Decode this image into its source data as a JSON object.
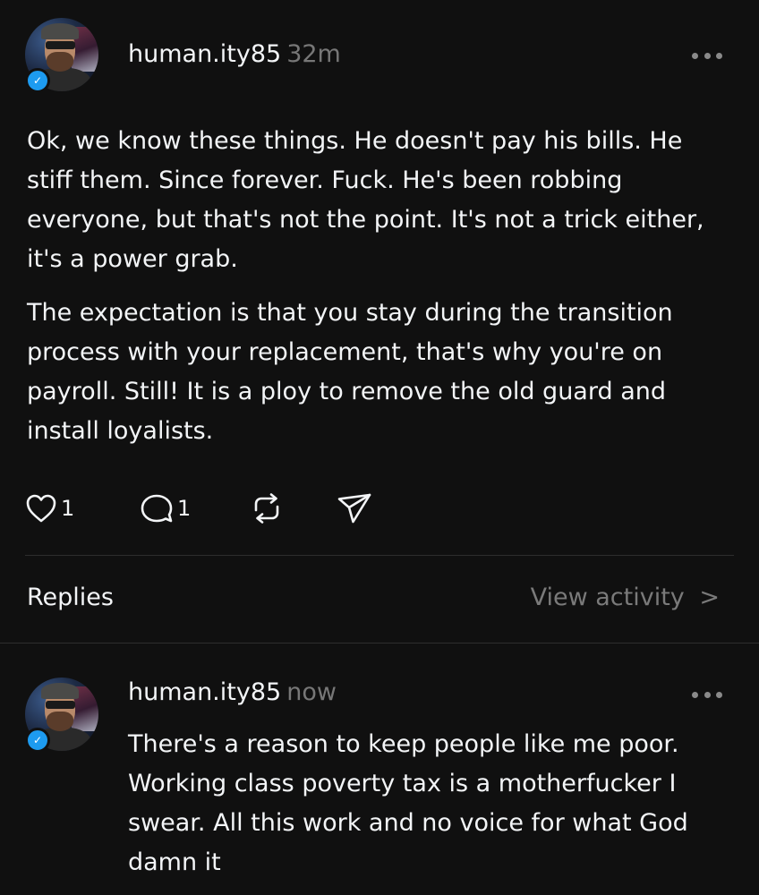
{
  "post": {
    "username": "human.ity85",
    "time": "32m",
    "paragraphs": [
      "Ok, we know these things. He doesn't pay his bills. He stiff them. Since forever. Fuck. He's been robbing everyone, but that's not the point. It's not a trick either, it's a power grab.",
      "The expectation is that you stay during the transition process with your replacement, that's why you're on payroll. Still! It is a ploy to remove the old guard and install loyalists."
    ],
    "likes": "1",
    "comments": "1",
    "verified_mark": "✓"
  },
  "replies_section": {
    "label": "Replies",
    "view_activity": "View activity",
    "chevron": ">"
  },
  "reply": {
    "username": "human.ity85",
    "time": "now",
    "text": "There's a reason to keep people like me poor. Working class poverty tax is a motherfucker I swear. All this work and no voice for what God damn it",
    "verified_mark": "✓"
  },
  "colors": {
    "background": "#101010",
    "text": "#f3f5f7",
    "muted": "#777777",
    "verified": "#1d9bf0",
    "divider": "#2d2d2d"
  },
  "icons": [
    "heart-icon",
    "comment-icon",
    "repost-icon",
    "share-icon",
    "more-icon",
    "verified-icon",
    "chevron-right-icon"
  ]
}
